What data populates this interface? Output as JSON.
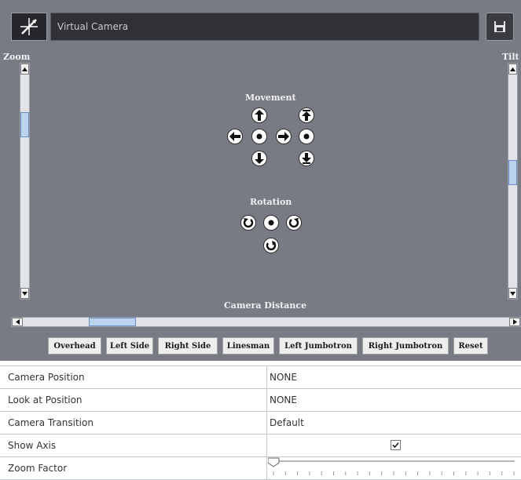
{
  "window": {
    "title": "Virtual Camera"
  },
  "labels": {
    "zoom": "Zoom",
    "tilt": "Tilt",
    "movement": "Movement",
    "rotation": "Rotation",
    "camera_distance": "Camera Distance"
  },
  "scrollbars": {
    "zoom_position": 0.2,
    "tilt_position": 0.45,
    "camera_distance_position": 0.15
  },
  "presets": [
    "Overhead",
    "Left Side",
    "Right Side",
    "Linesman",
    "Left Jumbotron",
    "Right Jumbotron",
    "Reset"
  ],
  "properties": [
    {
      "name": "Camera Position",
      "value": "NONE"
    },
    {
      "name": "Look at Position",
      "value": "NONE"
    },
    {
      "name": "Camera Transition",
      "value": "Default"
    },
    {
      "name": "Show Axis",
      "checked": true
    },
    {
      "name": "Zoom Factor",
      "slider_value": 0.0
    }
  ],
  "icons": {
    "logo": "axis-logo-icon",
    "save": "floppy-disk-icon"
  },
  "colors": {
    "panel_bg": "#787b84",
    "title_bar": "#303136",
    "thumb": "#bcd3ee"
  }
}
